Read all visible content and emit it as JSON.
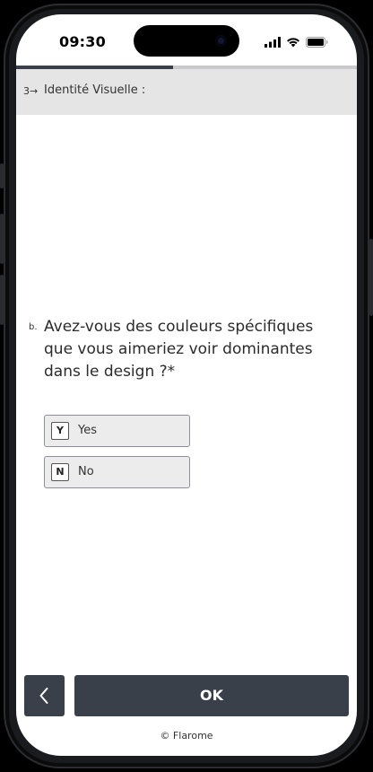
{
  "status_bar": {
    "time": "09:30",
    "icons": [
      "signal-icon",
      "wifi-icon",
      "battery-icon"
    ]
  },
  "progress": {
    "fraction": 0.46,
    "color": "#3a404a"
  },
  "section": {
    "number": "3→",
    "title": "Identité Visuelle :"
  },
  "question": {
    "id": "b.",
    "text": "Avez-vous des couleurs spécifiques que vous aimeriez voir dominantes dans le design ?*"
  },
  "choices": [
    {
      "key": "Y",
      "label": "Yes"
    },
    {
      "key": "N",
      "label": "No"
    }
  ],
  "nav": {
    "back_icon": "chevron-left-icon",
    "ok_label": "OK"
  },
  "footer": {
    "text": "© Flarome"
  },
  "colors": {
    "button_bg": "#3a404a",
    "header_bg": "#e5e5e6",
    "choice_bg": "#ececec"
  }
}
